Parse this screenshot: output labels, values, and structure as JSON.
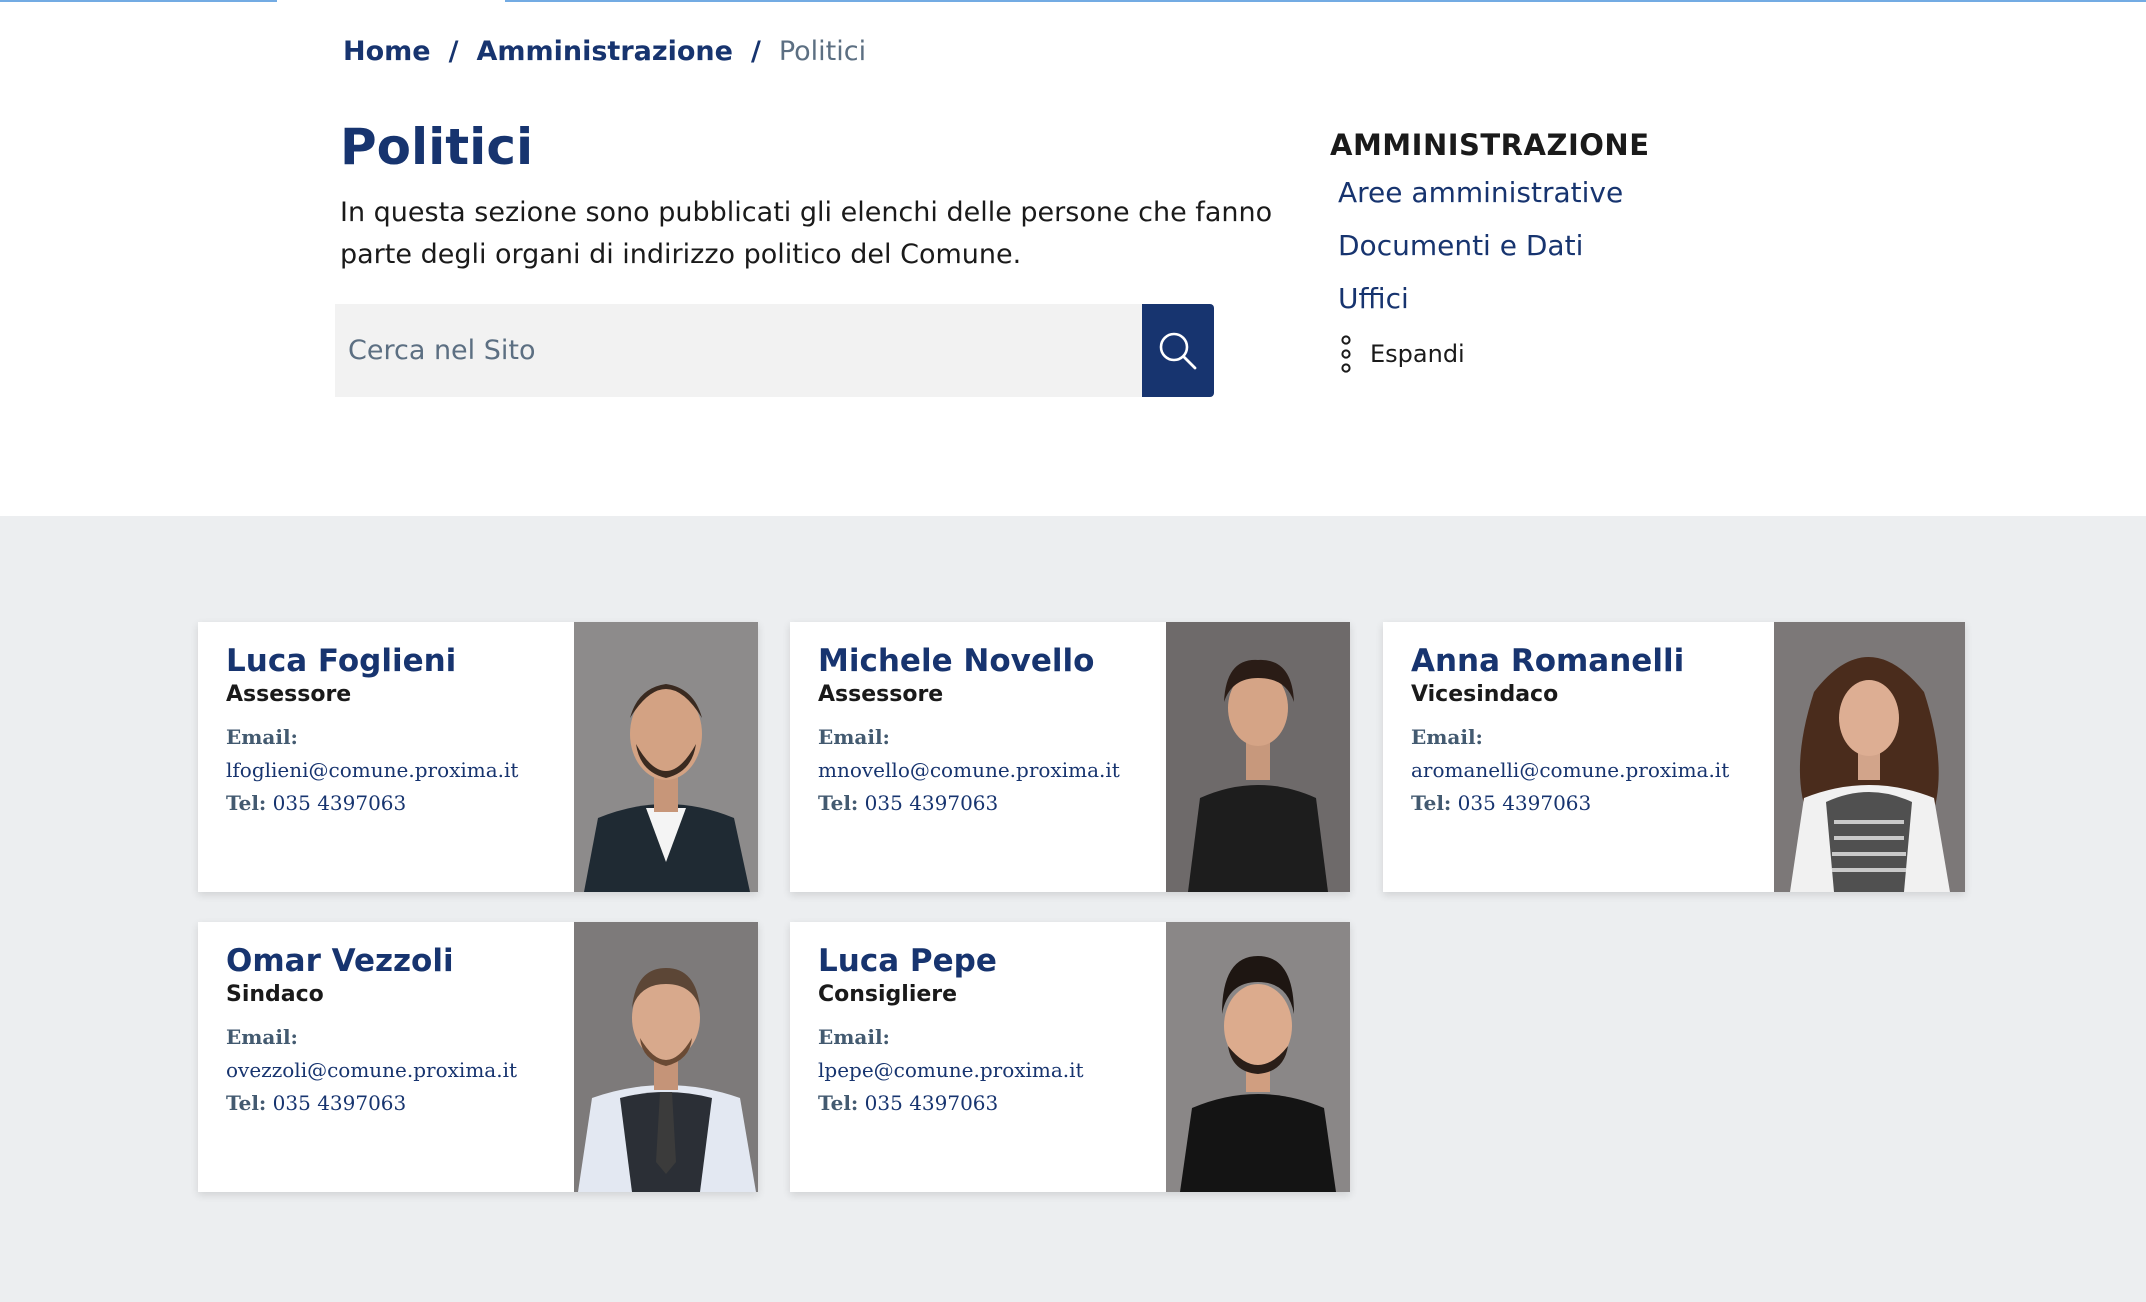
{
  "breadcrumb": {
    "home": "Home",
    "section": "Amministrazione",
    "current": "Politici",
    "separator": "/"
  },
  "page": {
    "title": "Politici",
    "description": "In questa sezione sono pubblicati gli elenchi delle persone che fanno parte degli organi di indirizzo politico del Comune."
  },
  "search": {
    "placeholder": "Cerca nel Sito",
    "icon": "search-icon"
  },
  "sidebar": {
    "title": "AMMINISTRAZIONE",
    "links": [
      {
        "label": "Aree amministrative"
      },
      {
        "label": "Documenti e Dati"
      },
      {
        "label": "Uffici"
      }
    ],
    "expand_label": "Espandi"
  },
  "labels": {
    "email": "Email:",
    "tel": "Tel:"
  },
  "people": [
    {
      "name": "Luca Foglieni",
      "role": "Assessore",
      "email": "lfoglieni@comune.proxima.it",
      "tel": "035 4397063"
    },
    {
      "name": "Michele Novello",
      "role": "Assessore",
      "email": "mnovello@comune.proxima.it",
      "tel": "035 4397063"
    },
    {
      "name": "Anna Romanelli",
      "role": "Vicesindaco",
      "email": "aromanelli@comune.proxima.it",
      "tel": "035 4397063"
    },
    {
      "name": "Omar Vezzoli",
      "role": "Sindaco",
      "email": "ovezzoli@comune.proxima.it",
      "tel": "035 4397063"
    },
    {
      "name": "Luca Pepe",
      "role": "Consigliere",
      "email": "lpepe@comune.proxima.it",
      "tel": "035 4397063"
    }
  ],
  "colors": {
    "primary": "#17346f",
    "band": "#eceef0",
    "muted": "#5c6f82"
  }
}
